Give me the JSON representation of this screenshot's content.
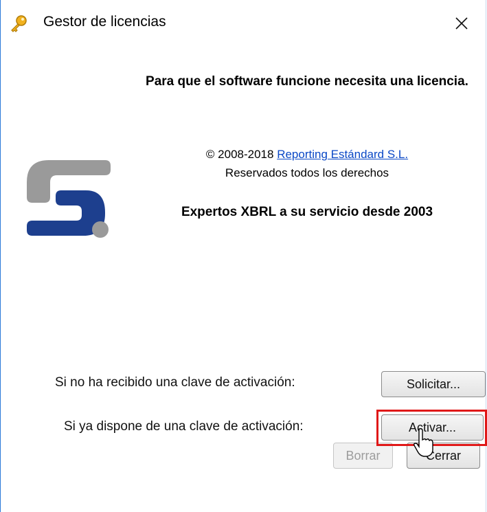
{
  "window": {
    "title": "Gestor de licencias",
    "title_icon": "key-icon",
    "close_icon": "close-icon"
  },
  "content": {
    "headline": "Para que el software funcione necesita una licencia.",
    "copyright_prefix": "© 2008-2018",
    "company_link": "Reporting Estándard S.L.",
    "rights": "Reservados todos los derechos",
    "tagline": "Expertos XBRL a su servicio desde 2003",
    "logo_icon": "company-logo"
  },
  "actions": {
    "request_label": "Si no ha recibido una clave de activación:",
    "request_button": "Solicitar...",
    "activate_label": "Si ya dispone de una clave de activación:",
    "activate_button": "Activar...",
    "clear_button": "Borrar",
    "close_button": "Cerrar"
  },
  "colors": {
    "link": "#0a48c6",
    "highlight": "#e01818",
    "logo_blue": "#1d3f8e",
    "logo_gray": "#9a9a9a"
  }
}
